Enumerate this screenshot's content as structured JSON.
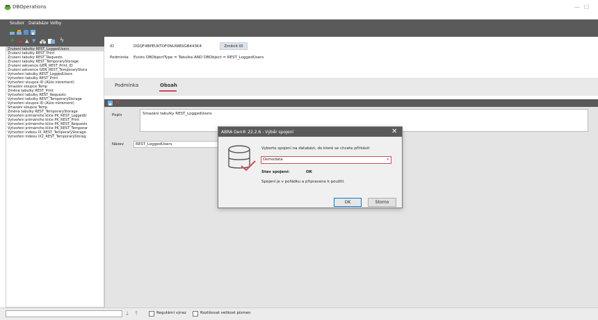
{
  "window": {
    "title": "DBOperations",
    "icon": "app-icon",
    "controls": [
      "minimize-icon",
      "maximize-icon"
    ]
  },
  "menu": {
    "items": [
      "Soubor",
      "Databáze",
      "Volby"
    ]
  },
  "toolbar": {
    "icons": [
      "add-icon",
      "remove-icon",
      "up-icon",
      "down-icon",
      "binoculars-icon",
      "copy-icon",
      "lightning-icon"
    ]
  },
  "header": {
    "id_label": "ID",
    "id_value": "DDQF4BPEUKTOF0NUWBSGB443K4",
    "change_id_button": "Změnit ID",
    "condition_label": "Podmínka",
    "condition_value": "Exists DBObjectType = Tabulka AND DBObject = REST_LoggedUsers"
  },
  "tabs": {
    "items": [
      "Podmínka",
      "Obsah"
    ],
    "active": "Obsah"
  },
  "content": {
    "popis_label": "Popis",
    "popis_value": "Smazání tabulky REST_LoggedUsers",
    "nazev_label": "Název",
    "nazev_value": "REST_LoggedUsers"
  },
  "left_list": {
    "selected_index": 0,
    "items": [
      "Zrušení tabulky REST_LoggedUsers",
      "Zrušení tabulky REST_Print",
      "Zrušení tabulky REST_Requests",
      "Zrušení tabulky REST_TemporaryStorage",
      "Zrušení sekvence GEN_REST_Print_ID",
      "Zrušení sekvence GEN_REST_TemporaryStora",
      "Vytvoření tabulky REST_LoggedUsers",
      "Vytvoření tabulky REST_Print",
      "Vytvoření sloupce ID (Auto inkrement)",
      "Smazání sloupce Temp",
      "Změna tabulky REST_Print",
      "Vytvoření tabulky REST_Requests",
      "Vytvoření tabulky REST_TemporaryStorage",
      "Vytvoření sloupce ID (Auto inkrement)",
      "Smazání sloupce Temp",
      "Změna tabulky REST_TemporaryStorage",
      "Vytvoření primárního klíče PK_REST_LoggedU",
      "Vytvoření primárního klíče PK_REST_Print",
      "Vytvoření primárního klíče PK_REST_Requests",
      "Vytvoření primárního klíče PK_REST_Temporar",
      "Vytvoření indexu IX_REST_TemporaryStorage",
      "Vytvoření indexu IX2_REST_TemporaryStorag"
    ]
  },
  "bottom": {
    "search_value": "",
    "regex_label": "Regulární výraz",
    "case_label": "Rozlišovat velikost písmen",
    "arrow_down_icon": "arrow-down-icon",
    "arrow_up_icon": "arrow-up-icon"
  },
  "dialog": {
    "title": "ABRA Gen® 22.2.6 - Výběr spojení",
    "prompt": "Vyberte spojení na databázi, do které se chcete přihlásit",
    "selected_connection": "Demodata",
    "status_label": "Stav spojení:",
    "status_value": "OK",
    "status_message": "Spojení je v pořádku a připraveno k použití.",
    "ok_button": "OK",
    "cancel_button": "Storno",
    "accent_color": "#d24a5c"
  }
}
